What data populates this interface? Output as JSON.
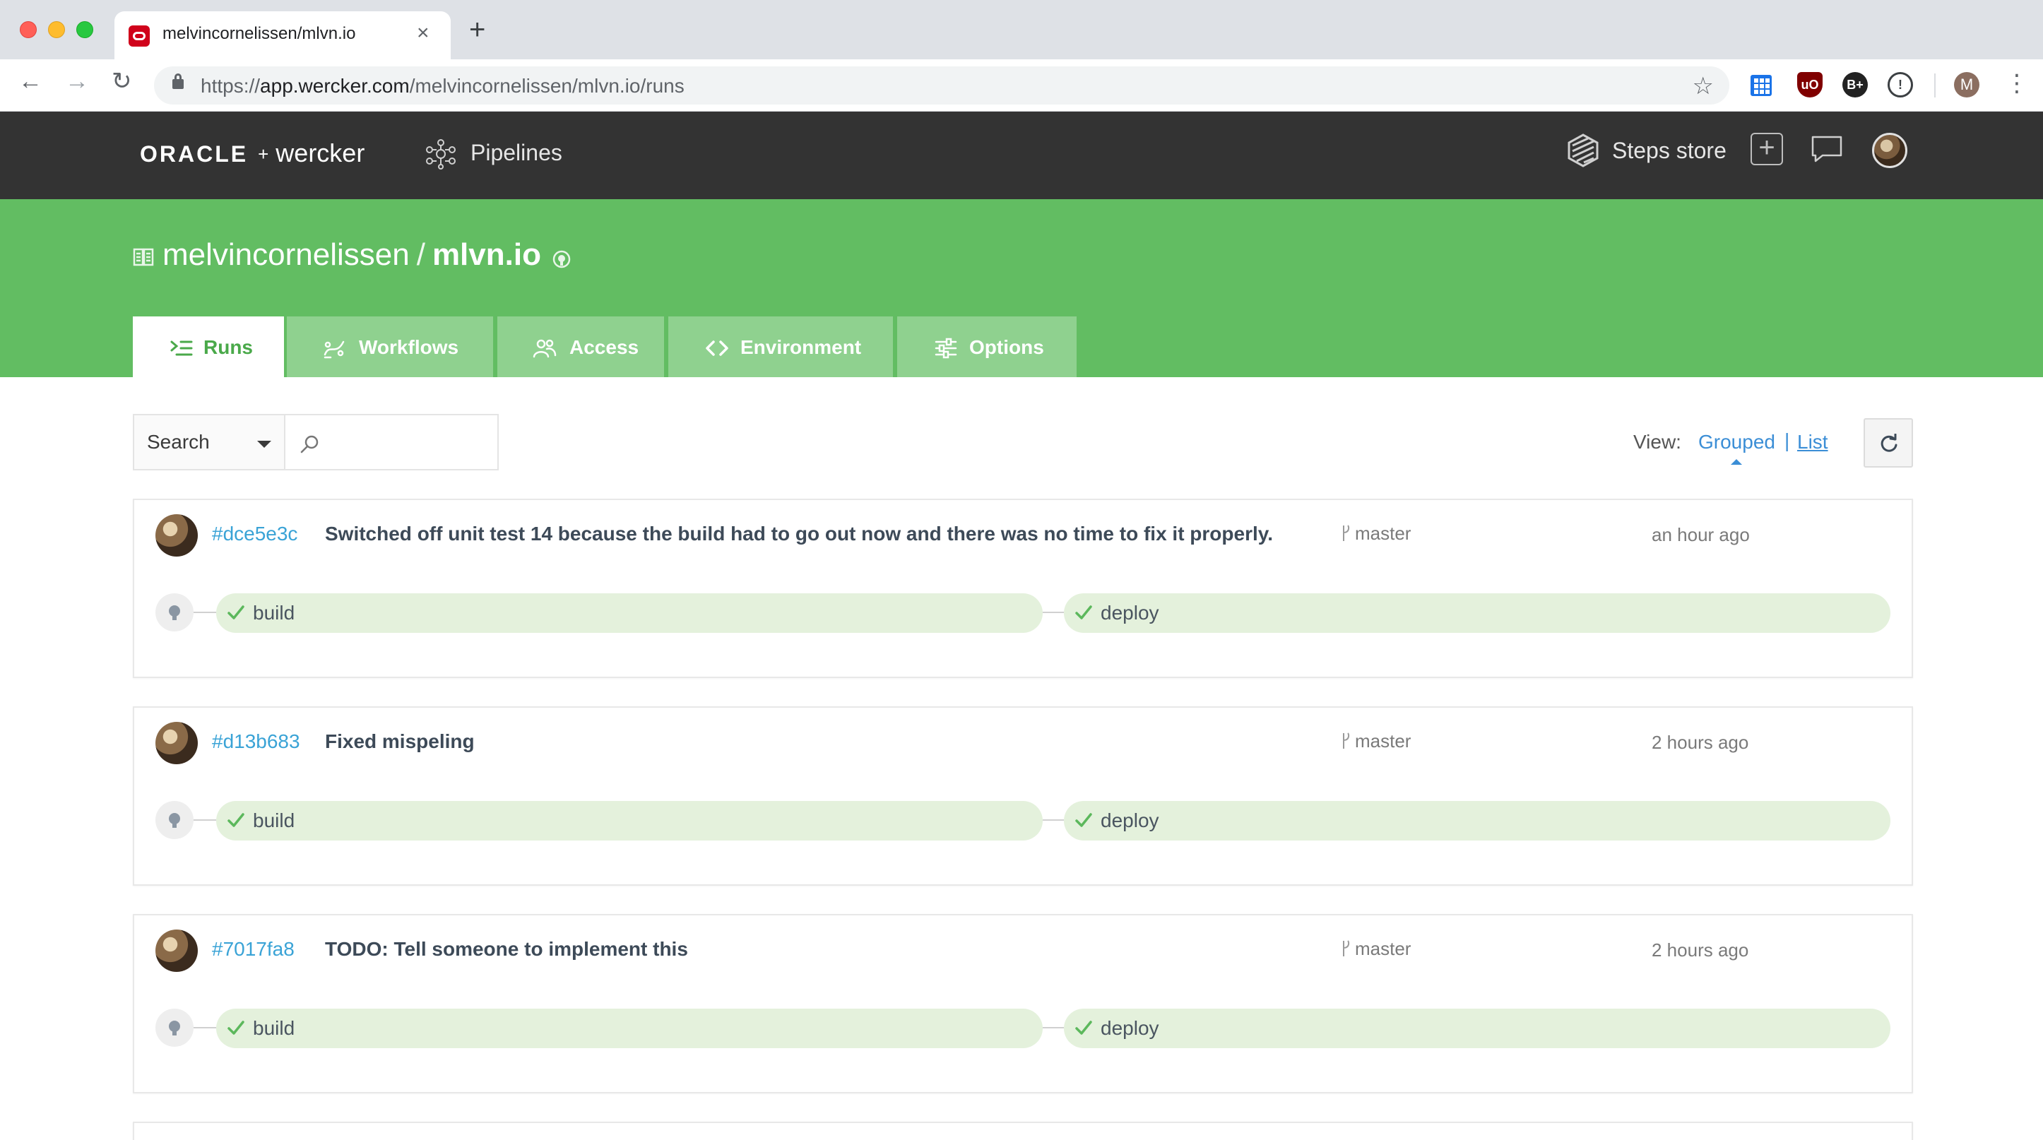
{
  "browser": {
    "tab_title": "melvincornelissen/mlvn.io",
    "url_scheme": "https://",
    "url_host": "app.wercker.com",
    "url_path": "/melvincornelissen/mlvn.io/runs",
    "profile_initial": "M",
    "ext_bplus": "B+",
    "ext_ublock": "uO"
  },
  "header": {
    "brand_oracle": "ORACLE",
    "brand_plus": "+",
    "brand_wercker": "wercker",
    "pipelines_label": "Pipelines",
    "steps_store_label": "Steps store"
  },
  "project": {
    "owner": "melvincornelissen",
    "separator": "/",
    "name": "mlvn.io",
    "tabs": [
      {
        "label": "Runs",
        "active": true
      },
      {
        "label": "Workflows",
        "active": false
      },
      {
        "label": "Access",
        "active": false
      },
      {
        "label": "Environment",
        "active": false
      },
      {
        "label": "Options",
        "active": false
      }
    ]
  },
  "filters": {
    "search_select": "Search",
    "search_placeholder": "",
    "view_label": "View:",
    "view_grouped": "Grouped",
    "view_divider": "|",
    "view_list": "List",
    "active_view": "Grouped"
  },
  "runs": [
    {
      "hash": "#dce5e3c",
      "message": "Switched off unit test 14 because the build had to go out now and there was no time to fix it properly.",
      "branch": "master",
      "time": "an hour ago",
      "pipelines": [
        {
          "label": "build",
          "status": "passed"
        },
        {
          "label": "deploy",
          "status": "passed"
        }
      ]
    },
    {
      "hash": "#d13b683",
      "message": "Fixed mispeling",
      "branch": "master",
      "time": "2 hours ago",
      "pipelines": [
        {
          "label": "build",
          "status": "passed"
        },
        {
          "label": "deploy",
          "status": "passed"
        }
      ]
    },
    {
      "hash": "#7017fa8",
      "message": "TODO: Tell someone to implement this",
      "branch": "master",
      "time": "2 hours ago",
      "pipelines": [
        {
          "label": "build",
          "status": "passed"
        },
        {
          "label": "deploy",
          "status": "passed"
        }
      ]
    }
  ],
  "colors": {
    "banner_green": "#62bd62",
    "tab_inactive": "#8fd18f",
    "header_dark": "#333333",
    "link_blue": "#3aa3d6",
    "pipeline_bg": "#e4f1dc",
    "check_green": "#5cb85c"
  }
}
